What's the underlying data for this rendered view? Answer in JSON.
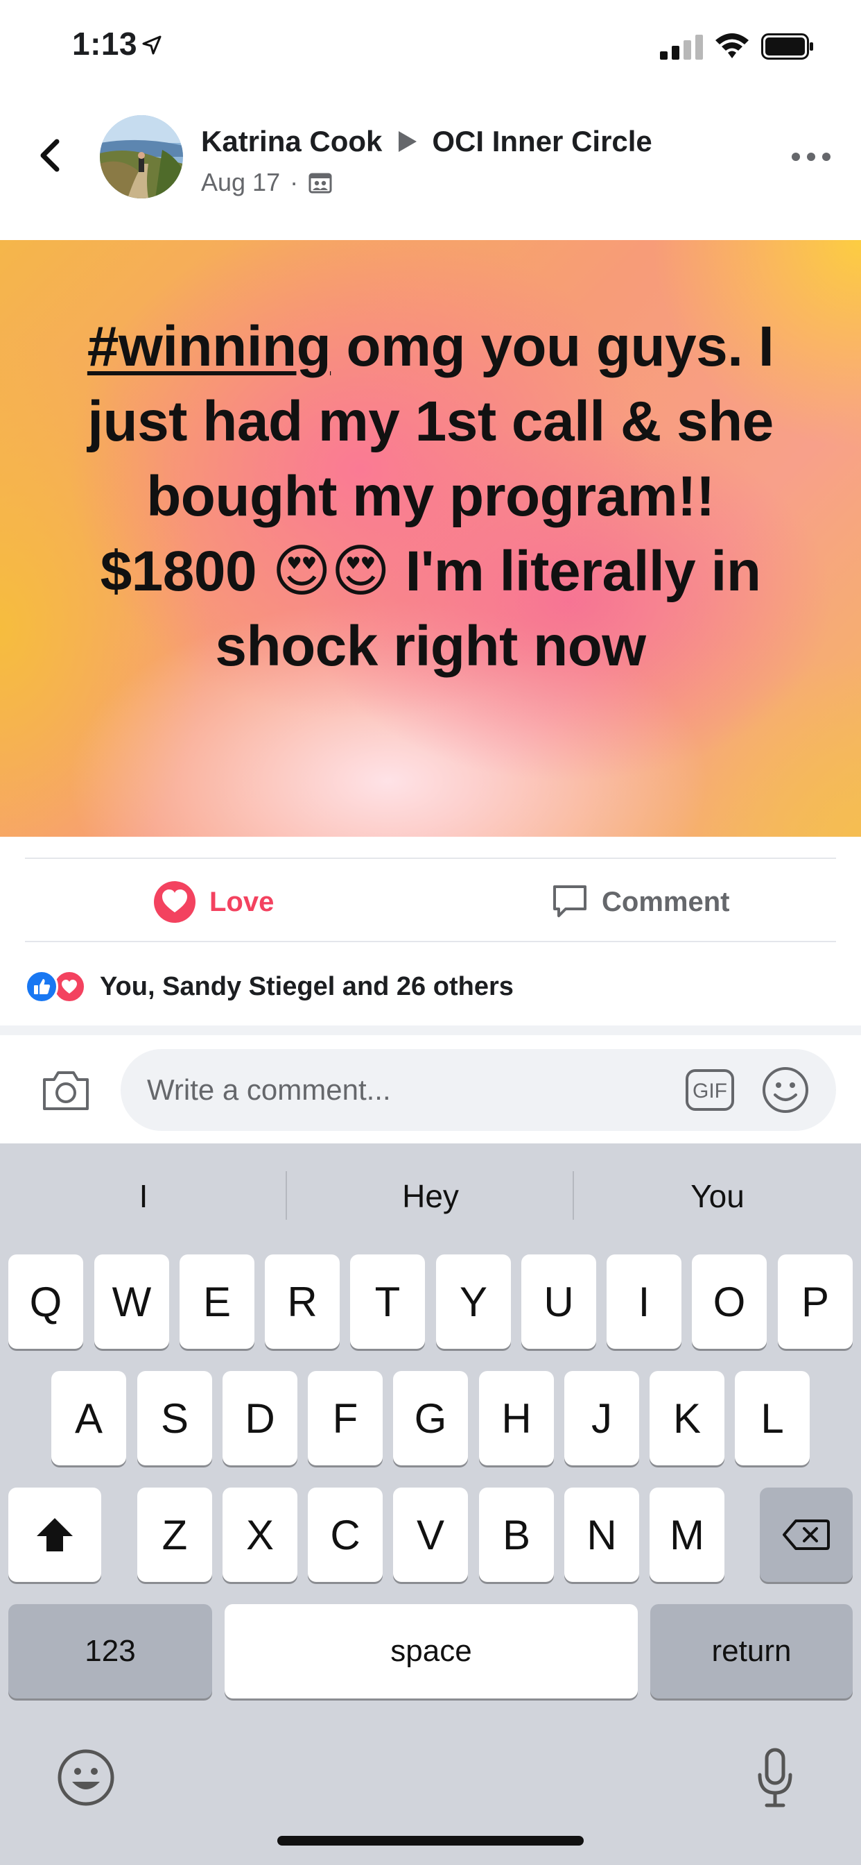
{
  "status_bar": {
    "time": "1:13"
  },
  "post": {
    "author": "Katrina Cook",
    "group": "OCI Inner Circle",
    "date": "Aug 17",
    "separator": "·",
    "hashtag": "#winning",
    "text_body": " omg you guys. I just had my 1st call & she bought my program!! $1800 😍😍 I'm literally in shock right now",
    "background_colors": [
      "#f5b64a",
      "#f87a96",
      "#fcd042"
    ]
  },
  "actions": {
    "love_label": "Love",
    "comment_label": "Comment",
    "love_color": "#f3425f"
  },
  "reactions": {
    "summary": "You, Sandy Stiegel and 26 others",
    "icons": [
      "like-icon",
      "love-icon"
    ]
  },
  "comment_box": {
    "placeholder": "Write a comment...",
    "gif_label": "GIF"
  },
  "keyboard": {
    "suggestions": [
      "I",
      "Hey",
      "You"
    ],
    "row1": [
      "Q",
      "W",
      "E",
      "R",
      "T",
      "Y",
      "U",
      "I",
      "O",
      "P"
    ],
    "row2": [
      "A",
      "S",
      "D",
      "F",
      "G",
      "H",
      "J",
      "K",
      "L"
    ],
    "row3": [
      "Z",
      "X",
      "C",
      "V",
      "B",
      "N",
      "M"
    ],
    "numbers_label": "123",
    "space_label": "space",
    "return_label": "return"
  }
}
